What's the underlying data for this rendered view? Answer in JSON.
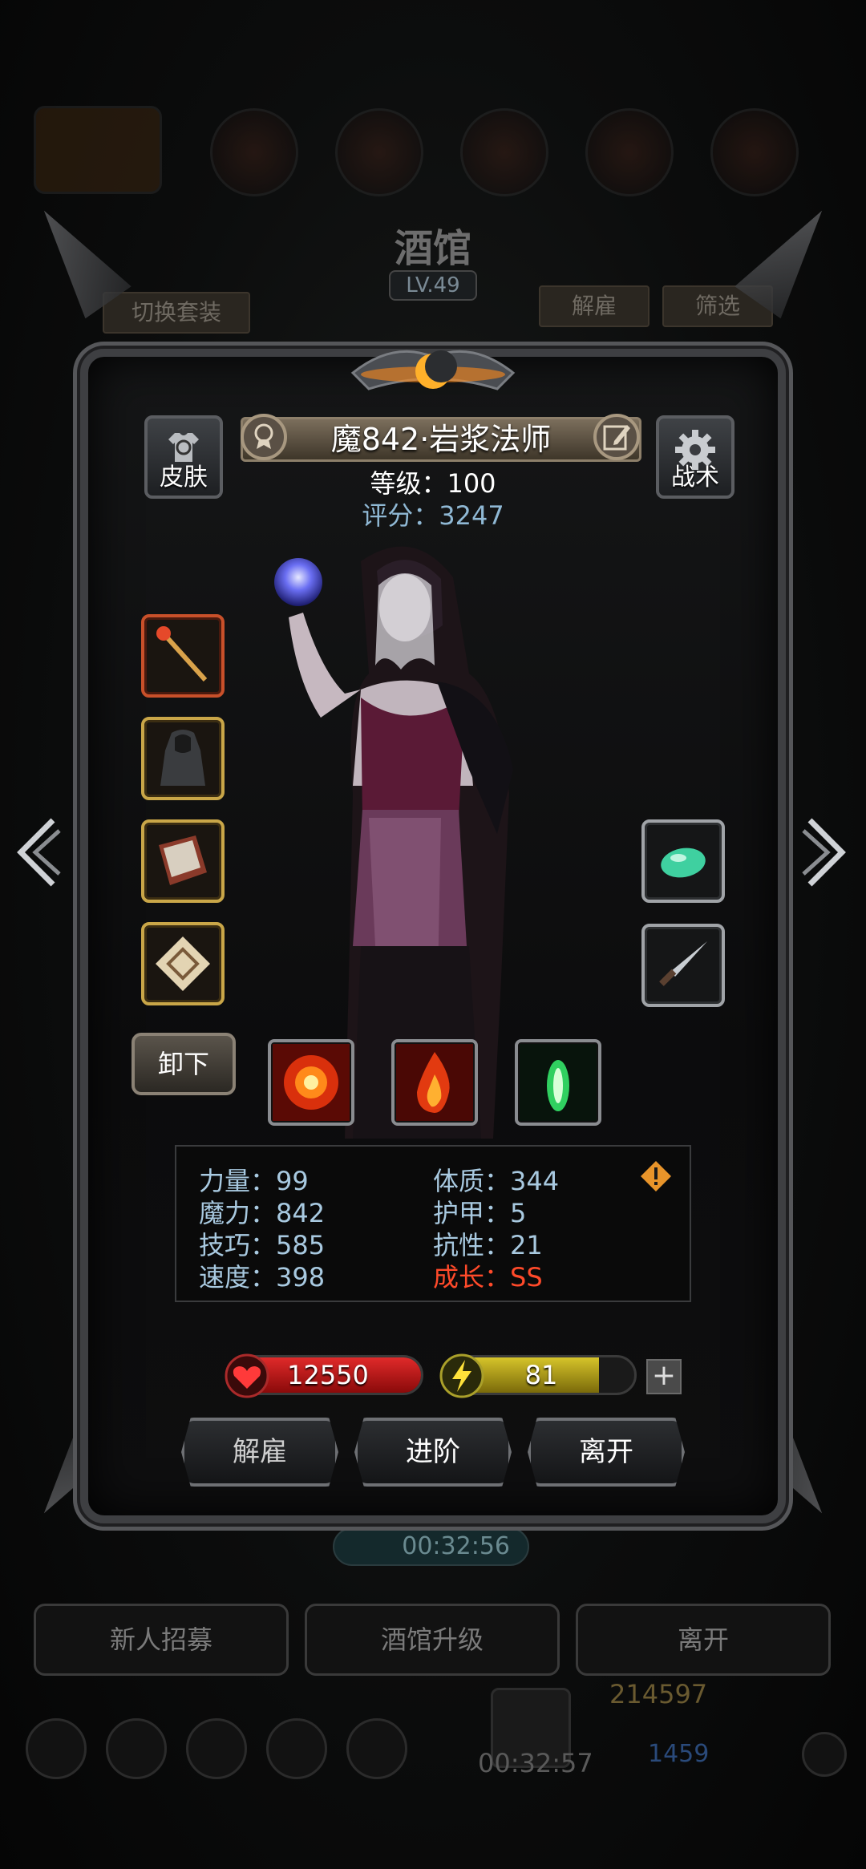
{
  "background": {
    "title": "酒馆",
    "level": "LV.49",
    "switch_outfit_label": "切换套装",
    "dismiss_label": "解雇",
    "filter_label": "筛选",
    "timer_top": "00:32:56",
    "recruit_label": "新人招募",
    "upgrade_label": "酒馆升级",
    "leave_label": "离开",
    "gold": "214597",
    "gems": "1459",
    "timer_bottom": "00:32:57"
  },
  "hero": {
    "skin_label": "皮肤",
    "tactics_label": "战术",
    "name": "魔842·岩浆法师",
    "level_line": "等级：100",
    "score_line": "评分：3247"
  },
  "equipment": {
    "left_slots": [
      "staff-icon",
      "robe-icon",
      "gauntlet-icon",
      "scroll-icon"
    ],
    "right_slots": [
      "gem-icon",
      "dagger-icon"
    ],
    "unequip_label": "卸下",
    "skills": [
      "fire-burst-icon",
      "flame-icon",
      "green-energy-icon"
    ]
  },
  "stats": {
    "strength": "力量：99",
    "constitution": "体质：344",
    "magic": "魔力：842",
    "armor": "护甲：5",
    "skill": "技巧：585",
    "resistance": "抗性：21",
    "speed": "速度：398",
    "growth": "成长：SS",
    "growth_color": "#ff4a2a"
  },
  "bars": {
    "hp": "12550",
    "hp_fraction": 1.0,
    "energy": "81",
    "energy_fraction": 0.81,
    "plus_label": "+"
  },
  "actions": {
    "dismiss": "解雇",
    "advance": "进阶",
    "leave": "离开"
  }
}
